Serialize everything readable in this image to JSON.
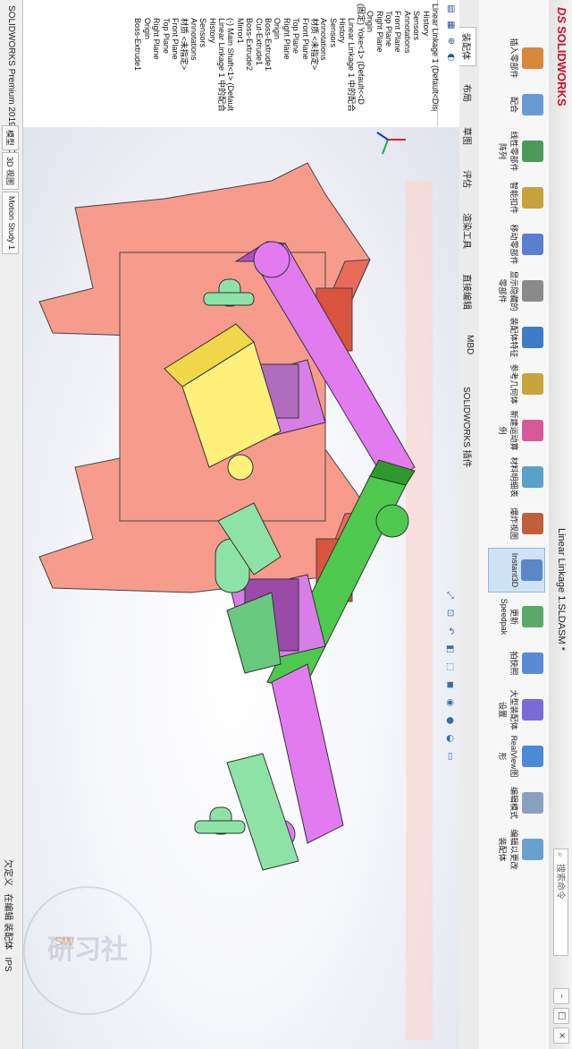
{
  "app": {
    "brand_prefix": "DS",
    "brand": "SOLIDWORKS",
    "document_title": "Linear Linkage 1.SLDASM *",
    "search_placeholder": "搜索命令",
    "colors": {
      "brand_red": "#c8102e",
      "selected_blue": "#cfe3f5"
    }
  },
  "ribbon": {
    "buttons": [
      {
        "label": "插入零部件",
        "icon": "insert-component-icon"
      },
      {
        "label": "配合",
        "icon": "mate-icon"
      },
      {
        "label": "线性零部件阵列",
        "icon": "linear-pattern-icon"
      },
      {
        "label": "智能扣件",
        "icon": "smart-fastener-icon"
      },
      {
        "label": "移动零部件",
        "icon": "move-component-icon"
      },
      {
        "label": "显示隐藏的零部件",
        "icon": "show-hidden-icon"
      },
      {
        "label": "装配体特征",
        "icon": "assembly-feature-icon"
      },
      {
        "label": "参考几何体",
        "icon": "reference-geometry-icon"
      },
      {
        "label": "新建运动算例",
        "icon": "motion-study-icon"
      },
      {
        "label": "材料明细表",
        "icon": "bom-icon"
      },
      {
        "label": "爆炸视图",
        "icon": "exploded-view-icon"
      },
      {
        "label": "Instant3D",
        "icon": "instant3d-icon"
      },
      {
        "label": "更新Speedpak",
        "icon": "speedpak-icon"
      },
      {
        "label": "拍快照",
        "icon": "snapshot-icon"
      },
      {
        "label": "大型装配体设置",
        "icon": "large-assembly-icon"
      },
      {
        "label": "RealView图形",
        "icon": "realview-icon"
      },
      {
        "label": "编辑模式",
        "icon": "edit-mode-icon"
      },
      {
        "label": "编辑以更改装配体",
        "icon": "edit-assembly-icon"
      }
    ],
    "selected_index": 11
  },
  "command_tabs": [
    "装配体",
    "布局",
    "草图",
    "评估",
    "渲染工具",
    "直接编辑",
    "MBD",
    "SOLIDWORKS 插件"
  ],
  "tree": {
    "tab_icons": [
      "feature-manager-icon",
      "property-manager-icon",
      "configuration-manager-icon",
      "display-manager-icon"
    ],
    "items": [
      "Linear Linkage 1 (Default<Disp",
      "History",
      "Sensors",
      "Annotations",
      "Front Plane",
      "Top Plane",
      "Right Plane",
      "Origin",
      "(固定) Yoke<1> (Default<<D",
      "Linear Linkage 1 中的配合",
      "History",
      "Sensors",
      "Annotations",
      "材质 <未指定>",
      "Front Plane",
      "Top Plane",
      "Right Plane",
      "Origin",
      "Boss-Extrude1",
      "Cut-Extrude1",
      "Boss-Extrude2",
      "Mirror1",
      "(-) Main Shaft<1> (Default<",
      "Linear Linkage 1 中的配合",
      "History",
      "Sensors",
      "Annotations",
      "材质 <未指定>",
      "Front Plane",
      "Top Plane",
      "Right Plane",
      "Origin",
      "Boss-Extrude1"
    ]
  },
  "status": {
    "version": "SOLIDWORKS Premium 2019 SP5.0",
    "model_tabs": [
      "模型",
      "3D 视图",
      "Motion Study 1"
    ],
    "state": "欠定义",
    "mode": "在编辑 装配体",
    "units": "IPS"
  },
  "watermark": {
    "text": "研习社",
    "sub": "SW"
  }
}
